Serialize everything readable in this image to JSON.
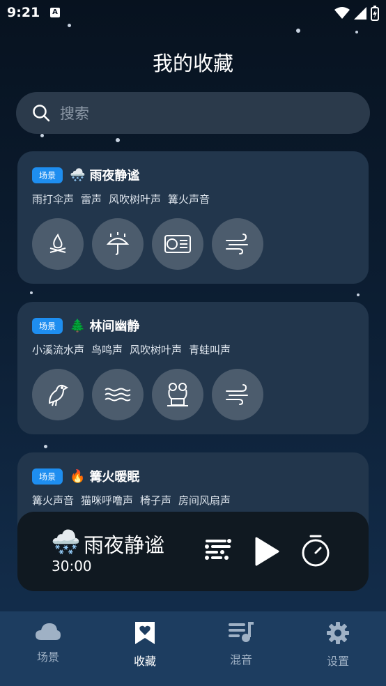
{
  "status": {
    "time": "9:21",
    "notif_icon": "A"
  },
  "page_title": "我的收藏",
  "search": {
    "placeholder": "搜索"
  },
  "cards": [
    {
      "badge": "场景",
      "emoji": "🌨️",
      "title": "雨夜静谧",
      "tags": [
        "雨打伞声",
        "雷声",
        "风吹树叶声",
        "篝火声音"
      ],
      "icons": [
        "campfire-icon",
        "umbrella-rain-icon",
        "fan-icon",
        "wind-icon"
      ]
    },
    {
      "badge": "场景",
      "emoji": "🌲",
      "title": "林间幽静",
      "tags": [
        "小溪流水声",
        "鸟鸣声",
        "风吹树叶声",
        "青蛙叫声"
      ],
      "icons": [
        "bird-icon",
        "water-waves-icon",
        "frog-icon",
        "wind-icon"
      ]
    },
    {
      "badge": "场景",
      "emoji": "🔥",
      "title": "篝火暖眠",
      "tags": [
        "篝火声音",
        "猫咪呼噜声",
        "椅子声",
        "房间风扇声"
      ],
      "icons": [
        "campfire-icon",
        "cat-icon",
        "fan-icon",
        "fan-box-icon"
      ]
    }
  ],
  "player": {
    "emoji": "🌨️",
    "title": "雨夜静谧",
    "time": "30:00"
  },
  "nav": [
    {
      "label": "场景",
      "icon": "cloud-icon",
      "active": false
    },
    {
      "label": "收藏",
      "icon": "bookmark-heart-icon",
      "active": true
    },
    {
      "label": "混音",
      "icon": "playlist-music-icon",
      "active": false
    },
    {
      "label": "设置",
      "icon": "gear-icon",
      "active": false
    }
  ],
  "colors": {
    "accent": "#1e8ef0",
    "card": "#22364c",
    "nav": "#1d3d60"
  }
}
